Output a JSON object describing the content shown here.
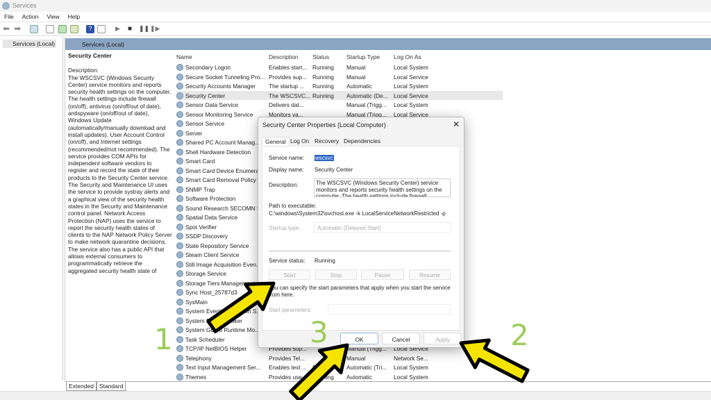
{
  "window": {
    "title": "Services"
  },
  "menu": [
    "File",
    "Action",
    "View",
    "Help"
  ],
  "tree": {
    "root": "Services (Local)"
  },
  "panel": {
    "header": "Services (Local)"
  },
  "description_pane": {
    "title": "Security Center",
    "label": "Description:",
    "text": "The WSCSVC (Windows Security Center) service monitors and reports security health settings on the computer.  The health settings include firewall (on/off), antivirus (on/off/out of date), antispyware (on/off/out of date), Windows Update (automatically/manually download and install updates), User Account Control (on/off), and Internet settings (recommended/not recommended). The service provides COM APIs for independent software vendors to register and record the state of their products to the Security Center service.  The Security and Maintenance UI uses the service to provide systray alerts and a graphical view of the security health states in the Security and Maintenance control panel.  Network Access Protection (NAP) uses the service to report the security health states of clients to the NAP Network Policy Server to make network quarantine decisions.  The service also has a public API that allows external consumers to programmatically retrieve the aggregated security health state of"
  },
  "columns": [
    "Name",
    "Description",
    "Status",
    "Startup Type",
    "Log On As"
  ],
  "services": [
    [
      "Secondary Logon",
      "Enables start...",
      "Running",
      "Manual",
      "Local System"
    ],
    [
      "Secure Socket Tunneling Pro...",
      "Provides sup...",
      "Running",
      "Manual",
      "Local Service"
    ],
    [
      "Security Accounts Manager",
      "The startup ...",
      "Running",
      "Automatic",
      "Local System"
    ],
    [
      "Security Center",
      "The WSCSVC...",
      "Running",
      "Automatic (De...",
      "Local Service"
    ],
    [
      "Sensor Data Service",
      "Delivers dat...",
      "",
      "Manual (Trigg...",
      "Local System"
    ],
    [
      "Sensor Monitoring Service",
      "Monitors va...",
      "",
      "Manual (Trigg...",
      "Local Service"
    ],
    [
      "Sensor Service",
      "",
      "",
      "",
      ""
    ],
    [
      "Server",
      "",
      "",
      "",
      ""
    ],
    [
      "Shared PC Account Manag...",
      "",
      "",
      "",
      ""
    ],
    [
      "Shell Hardware Detection",
      "",
      "",
      "",
      ""
    ],
    [
      "Smart Card",
      "",
      "",
      "",
      ""
    ],
    [
      "Smart Card Device Enumera...",
      "",
      "",
      "",
      ""
    ],
    [
      "Smart Card Removal Policy",
      "",
      "",
      "",
      ""
    ],
    [
      "SNMP Trap",
      "",
      "",
      "",
      ""
    ],
    [
      "Software Protection",
      "",
      "",
      "",
      ""
    ],
    [
      "Sound Research SECOMN S...",
      "",
      "",
      "",
      ""
    ],
    [
      "Spatial Data Service",
      "",
      "",
      "",
      ""
    ],
    [
      "Spot Verifier",
      "",
      "",
      "",
      ""
    ],
    [
      "SSDP Discovery",
      "",
      "",
      "",
      ""
    ],
    [
      "State Repository Service",
      "",
      "",
      "",
      ""
    ],
    [
      "Steam Client Service",
      "",
      "",
      "",
      ""
    ],
    [
      "Still Image Acquisition Even...",
      "",
      "",
      "",
      ""
    ],
    [
      "Storage Service",
      "",
      "",
      "",
      ""
    ],
    [
      "Storage Tiers Management",
      "",
      "",
      "",
      ""
    ],
    [
      "Sync Host_25787d3",
      "",
      "",
      "",
      ""
    ],
    [
      "SysMain",
      "",
      "",
      "",
      ""
    ],
    [
      "System Event Notification S...",
      "",
      "",
      "",
      ""
    ],
    [
      "System Events Broker",
      "",
      "",
      "",
      ""
    ],
    [
      "System Guard Runtime Mo...",
      "",
      "",
      "",
      ""
    ],
    [
      "Task Scheduler",
      "",
      "",
      "",
      ""
    ],
    [
      "TCP/IP NetBIOS Helper",
      "Provides sup...",
      "",
      "Manual (Trigg...",
      "Local Service"
    ],
    [
      "Telephony",
      "Provides Tel...",
      "",
      "Manual",
      "Network Se..."
    ],
    [
      "Text Input Management Ser...",
      "Enables text ...",
      "Running",
      "Automatic (Tri...",
      "Local System"
    ],
    [
      "Themes",
      "Provides use...",
      "Running",
      "Automatic",
      "Local System"
    ]
  ],
  "bottom_tabs": [
    "Extended",
    "Standard"
  ],
  "dialog": {
    "title": "Security Center Properties (Local Computer)",
    "tabs": [
      "General",
      "Log On",
      "Recovery",
      "Dependencies"
    ],
    "service_name_label": "Service name:",
    "service_name": "wscsvc",
    "display_name_label": "Display name:",
    "display_name": "Security Center",
    "description_label": "Description:",
    "description": "The WSCSVC (Windows Security Center) service monitors and reports security health settings on the computer.  The health settings include firewall",
    "path_label": "Path to executable:",
    "path": "C:\\windows\\System32\\svchost.exe -k LocalServiceNetworkRestricted -p",
    "startup_type_label": "Startup type:",
    "startup_type": "Automatic (Delayed Start)",
    "status_label": "Service status:",
    "status": "Running",
    "buttons": [
      "Start",
      "Stop",
      "Pause",
      "Resume"
    ],
    "hint": "You can specify the start parameters that apply when you start the service from here.",
    "start_params_label": "Start parameters:",
    "ok": "OK",
    "cancel": "Cancel",
    "apply": "Apply"
  },
  "annotations": {
    "numbers": [
      "1",
      "2",
      "3"
    ],
    "arrow_color": "#f5e400",
    "number_color": "#9ccc5a"
  }
}
